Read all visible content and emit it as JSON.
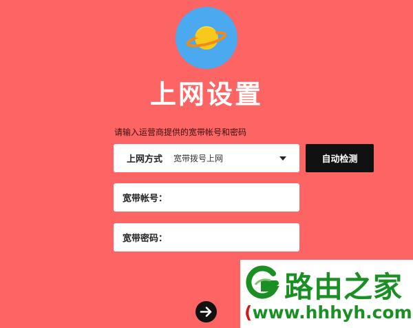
{
  "header": {
    "title": "上网设置"
  },
  "form": {
    "hint": "请输入运营商提供的宽带帐号和密码",
    "connection_type": {
      "label": "上网方式",
      "value": "宽带拨号上网"
    },
    "detect_button": "自动检测",
    "account": {
      "label": "宽带帐号：",
      "value": ""
    },
    "password": {
      "label": "宽带密码：",
      "value": ""
    }
  },
  "watermark": {
    "title": "路由之家",
    "url_open": "(",
    "url": "www.hhhyh.com",
    "url_close": ")"
  },
  "icons": {
    "logo": "planet-icon",
    "next": "arrow-right-icon"
  },
  "colors": {
    "background": "#fd6464",
    "logo_circle": "#4aa9ef",
    "button": "#111111",
    "watermark_green": "#1a8f24"
  }
}
